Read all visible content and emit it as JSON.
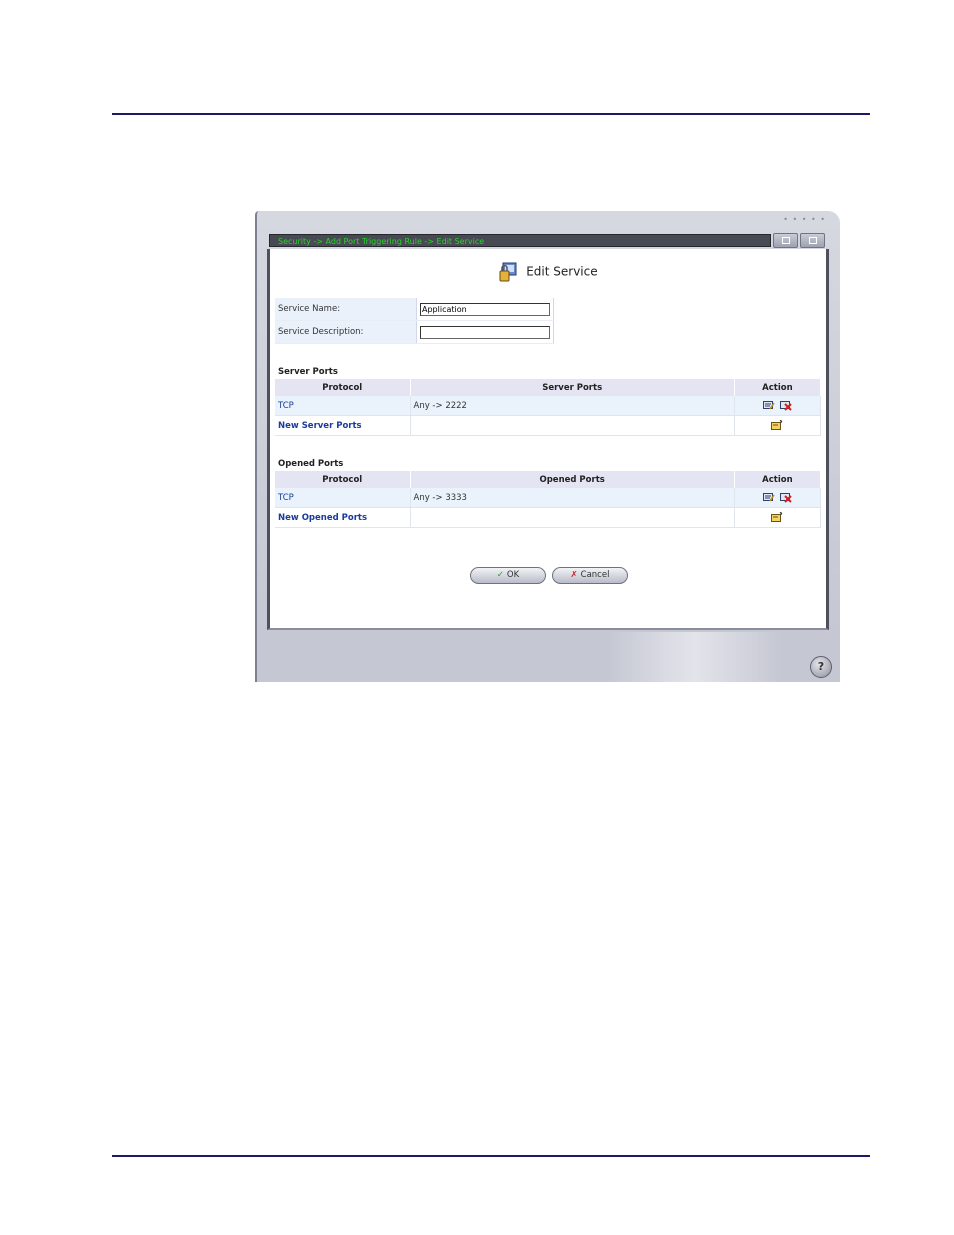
{
  "breadcrumb": "Security -> Add Port Triggering Rule -> Edit Service",
  "page_title": "Edit Service",
  "form": {
    "service_name_label": "Service Name:",
    "service_name_value": "Application",
    "service_description_label": "Service Description:",
    "service_description_value": ""
  },
  "server_ports": {
    "title": "Server Ports",
    "headers": [
      "Protocol",
      "Server Ports",
      "Action"
    ],
    "rows": [
      {
        "protocol": "TCP",
        "ports": "Any -> 2222"
      }
    ],
    "new_link": "New Server Ports"
  },
  "opened_ports": {
    "title": "Opened Ports",
    "headers": [
      "Protocol",
      "Opened Ports",
      "Action"
    ],
    "rows": [
      {
        "protocol": "TCP",
        "ports": "Any -> 3333"
      }
    ],
    "new_link": "New Opened Ports"
  },
  "buttons": {
    "ok": "OK",
    "cancel": "Cancel",
    "ok_mark": "✓",
    "cancel_mark": "✗"
  },
  "help_label": "?",
  "icons": [
    "service-icon",
    "edit-icon",
    "delete-icon",
    "new-icon",
    "help-icon",
    "network-map-icon",
    "list-icon"
  ],
  "colors": {
    "breadcrumb_text": "#2bd42b",
    "link": "#1a3c9c",
    "header_bg": "#e4e4f2",
    "rule": "#1a1a66"
  }
}
